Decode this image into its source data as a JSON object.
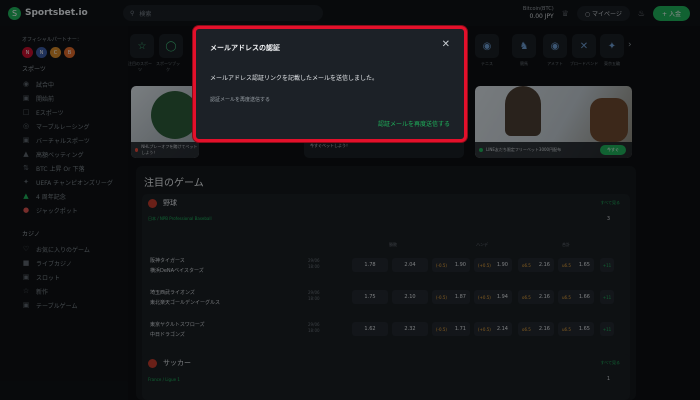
{
  "header": {
    "brand": "Sportsbet.io",
    "search_placeholder": "検索",
    "balance_label": "Bitcoin(BTC)",
    "balance_value": "0.00 JPY",
    "mypage_label": "マイページ",
    "deposit_label": "入金"
  },
  "sidebar": {
    "partner_label": "オフィシャルパートナー：",
    "section_sports": "スポーツ",
    "sports_items": [
      {
        "label": "試合中"
      },
      {
        "label": "開始前"
      },
      {
        "label": "Eスポーツ"
      },
      {
        "label": "マーブルレーシング"
      },
      {
        "label": "バーチャルスポーツ"
      },
      {
        "label": "高額ベッティング"
      },
      {
        "label": "BTC 上昇 Or 下落"
      },
      {
        "label": "UEFA チャンピオンズリーグ"
      },
      {
        "label": "4 周年記念"
      },
      {
        "label": "ジャックポット"
      }
    ],
    "section_casino": "カジノ",
    "casino_items": [
      {
        "label": "お気に入りのゲーム"
      },
      {
        "label": "ライブカジノ"
      },
      {
        "label": "スロット"
      },
      {
        "label": "新作"
      },
      {
        "label": "テーブルゲーム"
      }
    ]
  },
  "categories": [
    {
      "label": "注目のスポーツ"
    },
    {
      "label": "スポーツブック"
    }
  ],
  "categories_right": [
    {
      "label": "テニス"
    },
    {
      "label": "競馬"
    },
    {
      "label": "アメフト"
    },
    {
      "label": "ブロードバンド"
    },
    {
      "label": "東京五輪"
    }
  ],
  "banners": {
    "left_caption": "NHLプレーオフを賭けてベットしよう！",
    "mid_caption": "今すぐベットしよう！",
    "right_caption": "LINE友だち限定フリーベット3000円配布",
    "button": "今すぐ"
  },
  "featured": {
    "title": "注目のゲーム",
    "baseball": {
      "sport": "野球",
      "more": "すべて見る",
      "league": "日本 / NPB Professional Baseball",
      "count": "3",
      "col_headers": [
        "勝敗",
        "ハンデ",
        "合計"
      ],
      "matches": [
        {
          "home": "阪神タイガース",
          "away": "横浜DeNAベイスターズ",
          "date": "29/06",
          "time": "18:00",
          "o1": "1.78",
          "o2": "2.04",
          "h1": "(-0.5)",
          "h1o": "1.90",
          "h2": "(+0.5)",
          "h2o": "1.90",
          "t1": "o6.5",
          "t1o": "2.16",
          "t2": "u6.5",
          "t2o": "1.65",
          "more": "+11"
        },
        {
          "home": "埼玉西武ライオンズ",
          "away": "東北楽天ゴールデンイーグルス",
          "date": "29/06",
          "time": "18:00",
          "o1": "1.75",
          "o2": "2.10",
          "h1": "(-0.5)",
          "h1o": "1.87",
          "h2": "(+0.5)",
          "h2o": "1.94",
          "t1": "o6.5",
          "t1o": "2.16",
          "t2": "u6.5",
          "t2o": "1.66",
          "more": "+11"
        },
        {
          "home": "東京ヤクルトスワローズ",
          "away": "中日ドラゴンズ",
          "date": "29/06",
          "time": "18:00",
          "o1": "1.62",
          "o2": "2.32",
          "h1": "(-0.5)",
          "h1o": "1.71",
          "h2": "(+0.5)",
          "h2o": "2.14",
          "t1": "o6.5",
          "t1o": "2.16",
          "t2": "u6.5",
          "t2o": "1.65",
          "more": "+11"
        }
      ]
    },
    "soccer": {
      "sport": "サッカー",
      "more": "すべて見る",
      "league": "France / Ligue 1",
      "count": "1"
    }
  },
  "modal": {
    "title": "メールアドレスの認証",
    "message": "メールアドレス認証リンクを記載したメールを送信しました。",
    "subtext": "認証メールを再度送信する",
    "resend_label": "認証メールを再度送信する"
  }
}
